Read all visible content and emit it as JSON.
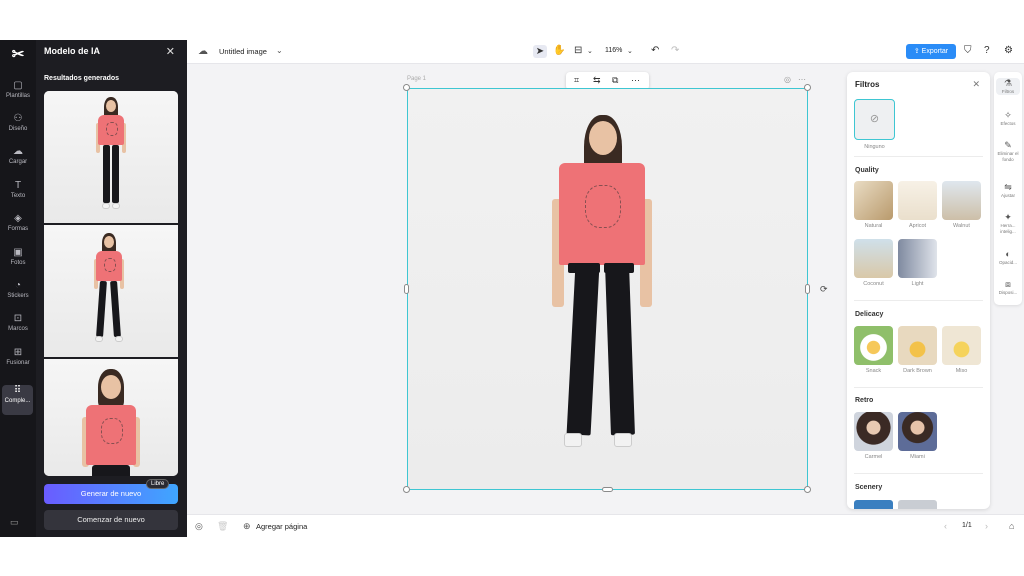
{
  "rail": {
    "items": [
      {
        "label": "Plantillas",
        "icon": "template-icon"
      },
      {
        "label": "Diseño",
        "icon": "design-icon"
      },
      {
        "label": "Cargar",
        "icon": "upload-icon"
      },
      {
        "label": "Texto",
        "icon": "text-icon"
      },
      {
        "label": "Formas",
        "icon": "shapes-icon"
      },
      {
        "label": "Fotos",
        "icon": "photos-icon"
      },
      {
        "label": "Stickers",
        "icon": "stickers-icon"
      },
      {
        "label": "Marcos",
        "icon": "frames-icon"
      },
      {
        "label": "Fusionar",
        "icon": "merge-icon"
      },
      {
        "label": "Comple...",
        "icon": "plugins-icon"
      }
    ]
  },
  "ai_panel": {
    "title": "Modelo de IA",
    "subtitle": "Resultados generados",
    "regenerate_label": "Generar de nuevo",
    "free_badge": "Libre",
    "restart_label": "Comenzar de nuevo"
  },
  "topbar": {
    "doc_title": "Untitled image",
    "zoom": "116%",
    "export_label": "Exportar"
  },
  "canvas": {
    "page_label": "Page 1",
    "accent": "#3ec6d2"
  },
  "filters": {
    "title": "Filtros",
    "none_label": "Ninguno",
    "sections": {
      "quality": {
        "title": "Quality",
        "items": [
          "Natural",
          "Apricot",
          "Walnut",
          "Coconut",
          "Light"
        ]
      },
      "delicacy": {
        "title": "Delicacy",
        "items": [
          "Snack",
          "Dark Brown",
          "Miso"
        ]
      },
      "retro": {
        "title": "Retro",
        "items": [
          "Carmel",
          "Miami"
        ]
      },
      "scenery": {
        "title": "Scenery"
      }
    }
  },
  "right_bar": {
    "items": [
      {
        "label": "Filtros",
        "icon": "filters-icon"
      },
      {
        "label": "Efectos",
        "icon": "effects-icon"
      },
      {
        "label": "Eliminar el fondo",
        "icon": "remove-bg-icon"
      },
      {
        "label": "Ajustar",
        "icon": "adjust-icon"
      },
      {
        "label": "Herra... intelig...",
        "icon": "smart-tools-icon"
      },
      {
        "label": "Opacid...",
        "icon": "opacity-icon"
      },
      {
        "label": "Disposi...",
        "icon": "arrange-icon"
      }
    ]
  },
  "bottombar": {
    "add_page_label": "Agregar página",
    "page_counter": "1/1"
  },
  "colors": {
    "export": "#2a8cf7",
    "selection": "#3ec6d2",
    "shirt": "#ee7276"
  }
}
